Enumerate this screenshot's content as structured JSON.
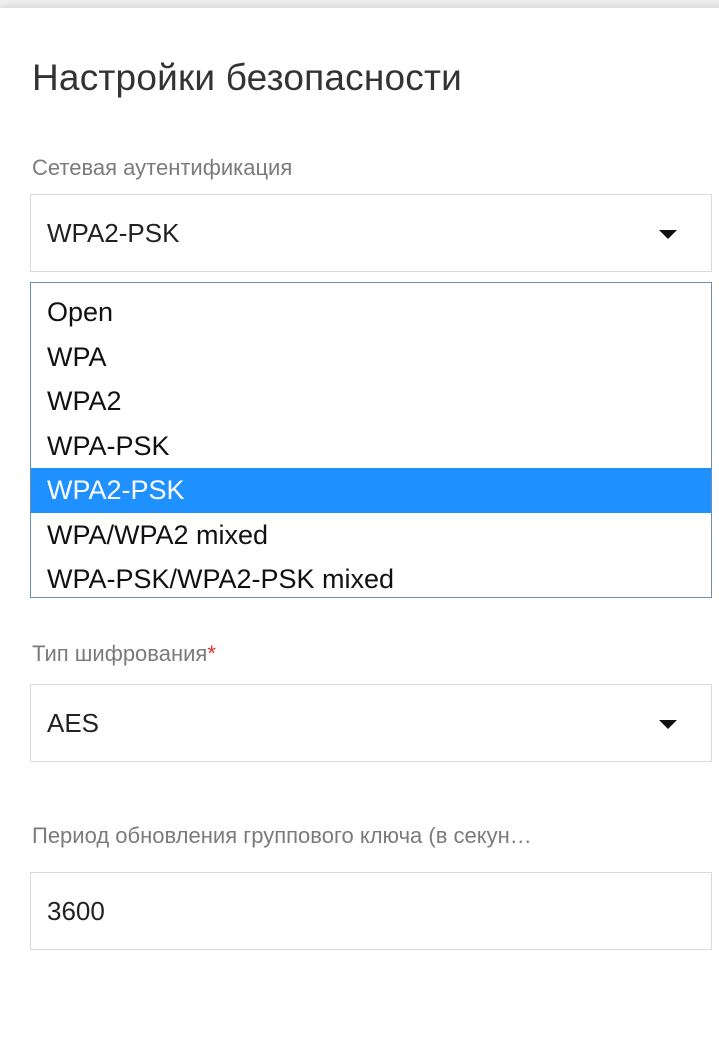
{
  "section": {
    "title": "Настройки безопасности"
  },
  "auth": {
    "label": "Сетевая аутентификация",
    "selected": "WPA2-PSK",
    "options": [
      "Open",
      "WPA",
      "WPA2",
      "WPA-PSK",
      "WPA2-PSK",
      "WPA/WPA2 mixed",
      "WPA-PSK/WPA2-PSK mixed"
    ],
    "highlighted_option": "WPA2-PSK"
  },
  "encryption": {
    "label": "Тип шифрования",
    "required_mark": "*",
    "selected": "AES"
  },
  "group_key": {
    "label": "Период обновления группового ключа (в секун…",
    "value": "3600"
  },
  "icons": {
    "dropdown_caret": "caret-down-icon"
  },
  "colors": {
    "selection_highlight": "#1e90ff",
    "required_star": "#d9332c",
    "dropdown_border": "#6d8fb5"
  }
}
